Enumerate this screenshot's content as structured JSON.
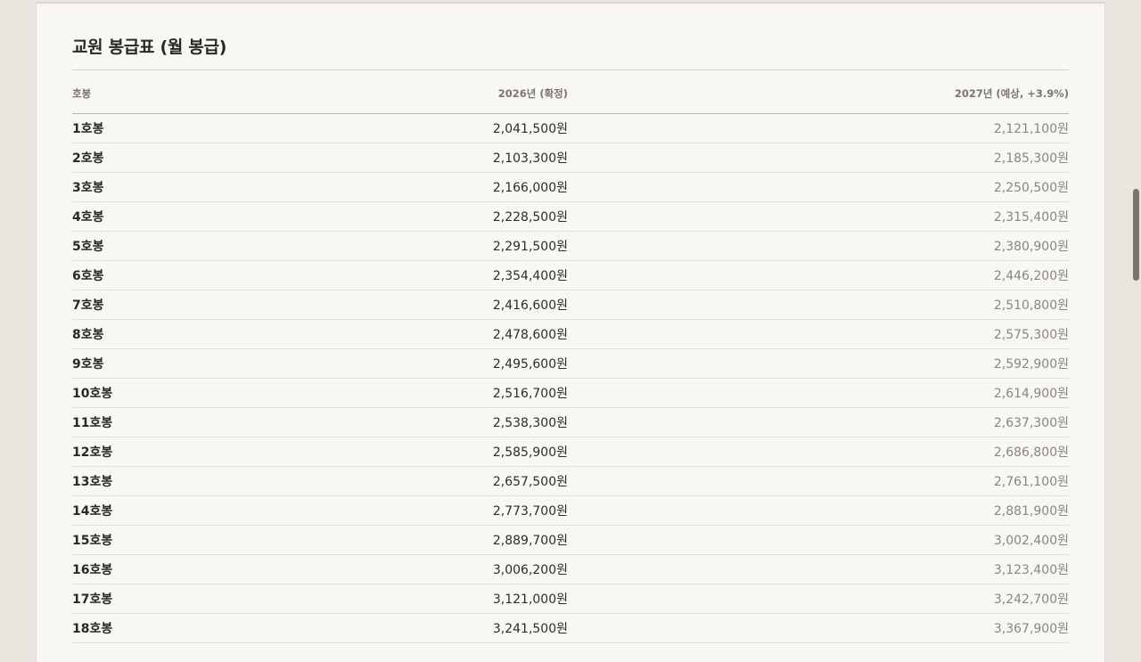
{
  "document": {
    "title": "교원 봉급표 (월 봉급)"
  },
  "table": {
    "headers": [
      "호봉",
      "2026년 (확정)",
      "2027년 (예상, +3.9%)"
    ],
    "rows": [
      [
        "1호봉",
        "2,041,500원",
        "2,121,100원"
      ],
      [
        "2호봉",
        "2,103,300원",
        "2,185,300원"
      ],
      [
        "3호봉",
        "2,166,000원",
        "2,250,500원"
      ],
      [
        "4호봉",
        "2,228,500원",
        "2,315,400원"
      ],
      [
        "5호봉",
        "2,291,500원",
        "2,380,900원"
      ],
      [
        "6호봉",
        "2,354,400원",
        "2,446,200원"
      ],
      [
        "7호봉",
        "2,416,600원",
        "2,510,800원"
      ],
      [
        "8호봉",
        "2,478,600원",
        "2,575,300원"
      ],
      [
        "9호봉",
        "2,495,600원",
        "2,592,900원"
      ],
      [
        "10호봉",
        "2,516,700원",
        "2,614,900원"
      ],
      [
        "11호봉",
        "2,538,300원",
        "2,637,300원"
      ],
      [
        "12호봉",
        "2,585,900원",
        "2,686,800원"
      ],
      [
        "13호봉",
        "2,657,500원",
        "2,761,100원"
      ],
      [
        "14호봉",
        "2,773,700원",
        "2,881,900원"
      ],
      [
        "15호봉",
        "2,889,700원",
        "3,002,400원"
      ],
      [
        "16호봉",
        "3,006,200원",
        "3,123,400원"
      ],
      [
        "17호봉",
        "3,121,000원",
        "3,242,700원"
      ],
      [
        "18호봉",
        "3,241,500원",
        "3,367,900원"
      ]
    ]
  },
  "scrollbar": {
    "position_fraction": 0.29
  }
}
